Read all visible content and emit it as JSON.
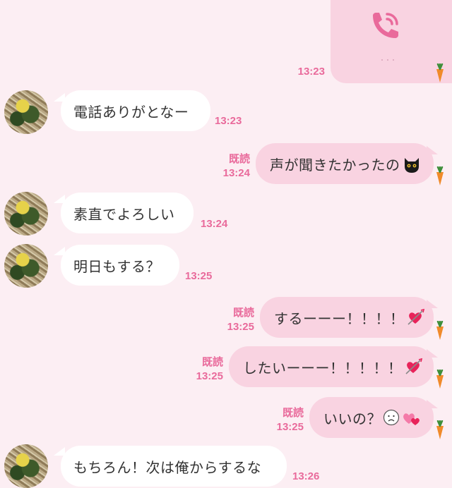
{
  "call": {
    "time": "13:23"
  },
  "messages": [
    {
      "side": "in",
      "text": "電話ありがとなー",
      "time": "13:23"
    },
    {
      "side": "out",
      "text": "声が聞きたかったの",
      "emoji": "black-cat-icon",
      "read": "既読",
      "time": "13:24"
    },
    {
      "side": "in",
      "text": "素直でよろしい",
      "time": "13:24"
    },
    {
      "side": "in",
      "text": "明日もする？",
      "time": "13:25"
    },
    {
      "side": "out",
      "text": "するーーー！！！！",
      "emoji": "heart-arrow-icon",
      "read": "既読",
      "time": "13:25"
    },
    {
      "side": "out",
      "text": "したいーーー！！！！！",
      "emoji": "heart-arrow-icon",
      "read": "既読",
      "time": "13:25"
    },
    {
      "side": "out",
      "text": "いいの？",
      "emoji": "worried-face-icon",
      "emoji2": "pink-hearts-icon",
      "read": "既読",
      "time": "13:25"
    },
    {
      "side": "in",
      "text": "もちろん！次は俺からするな",
      "time": "13:26"
    }
  ],
  "colors": {
    "background": "#fceef3",
    "outgoing_bubble": "#f9d3e1",
    "incoming_bubble": "#ffffff",
    "accent": "#e96a9b"
  }
}
